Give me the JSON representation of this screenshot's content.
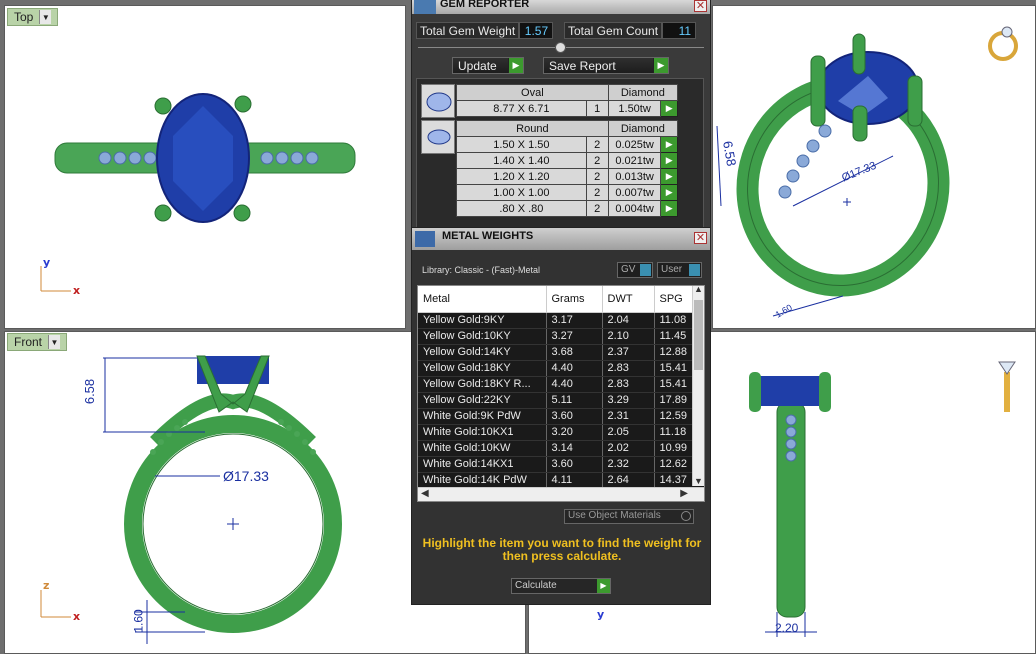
{
  "viewports": {
    "top": {
      "label": "Top"
    },
    "front": {
      "label": "Front"
    }
  },
  "dimensions": {
    "height_front": "6.58",
    "diameter_front": "Ø17.33",
    "shank_front": "1.60",
    "height_persp": "6.58",
    "diameter_persp": "Ø17.33",
    "shank_persp": "1.60",
    "width_right": "2.20"
  },
  "axes": {
    "x": "x",
    "y": "y",
    "z": "z"
  },
  "gem_reporter": {
    "title": "GEM REPORTER",
    "total_weight_label": "Total Gem Weight",
    "total_weight_value": "1.57",
    "total_count_label": "Total Gem Count",
    "total_count_value": "11",
    "update_label": "Update",
    "save_report_label": "Save Report",
    "groups": [
      {
        "shape": "Oval",
        "material": "Diamond",
        "rows": [
          {
            "size": "8.77 X 6.71",
            "qty": "1",
            "weight": "1.50tw"
          }
        ]
      },
      {
        "shape": "Round",
        "material": "Diamond",
        "rows": [
          {
            "size": "1.50 X 1.50",
            "qty": "2",
            "weight": "0.025tw"
          },
          {
            "size": "1.40 X 1.40",
            "qty": "2",
            "weight": "0.021tw"
          },
          {
            "size": "1.20 X 1.20",
            "qty": "2",
            "weight": "0.013tw"
          },
          {
            "size": "1.00 X 1.00",
            "qty": "2",
            "weight": "0.007tw"
          },
          {
            "size": ".80 X .80",
            "qty": "2",
            "weight": "0.004tw"
          }
        ]
      }
    ]
  },
  "metal_weights": {
    "title": "METAL WEIGHTS",
    "library": "Library: Classic - (Fast)-Metal",
    "gv_label": "GV",
    "user_label": "User",
    "columns": [
      "Metal",
      "Grams",
      "DWT",
      "SPG"
    ],
    "rows": [
      [
        "Yellow Gold:9KY",
        "3.17",
        "2.04",
        "11.08"
      ],
      [
        "Yellow Gold:10KY",
        "3.27",
        "2.10",
        "11.45"
      ],
      [
        "Yellow Gold:14KY",
        "3.68",
        "2.37",
        "12.88"
      ],
      [
        "Yellow Gold:18KY",
        "4.40",
        "2.83",
        "15.41"
      ],
      [
        "Yellow Gold:18KY R...",
        "4.40",
        "2.83",
        "15.41"
      ],
      [
        "Yellow Gold:22KY",
        "5.11",
        "3.29",
        "17.89"
      ],
      [
        "White Gold:9K PdW",
        "3.60",
        "2.31",
        "12.59"
      ],
      [
        "White Gold:10KX1",
        "3.20",
        "2.05",
        "11.18"
      ],
      [
        "White Gold:10KW",
        "3.14",
        "2.02",
        "10.99"
      ],
      [
        "White Gold:14KX1",
        "3.60",
        "2.32",
        "12.62"
      ],
      [
        "White Gold:14K PdW",
        "4.11",
        "2.64",
        "14.37"
      ]
    ],
    "use_object_materials": "Use Object Materials",
    "hint": "Highlight the item you want to find the weight for then press calculate.",
    "calculate_label": "Calculate"
  },
  "colors": {
    "ring": "#3f9e4a",
    "gem": "#1f3ea8",
    "dim": "#1a2fa0",
    "panel": "#3a3a3a"
  }
}
